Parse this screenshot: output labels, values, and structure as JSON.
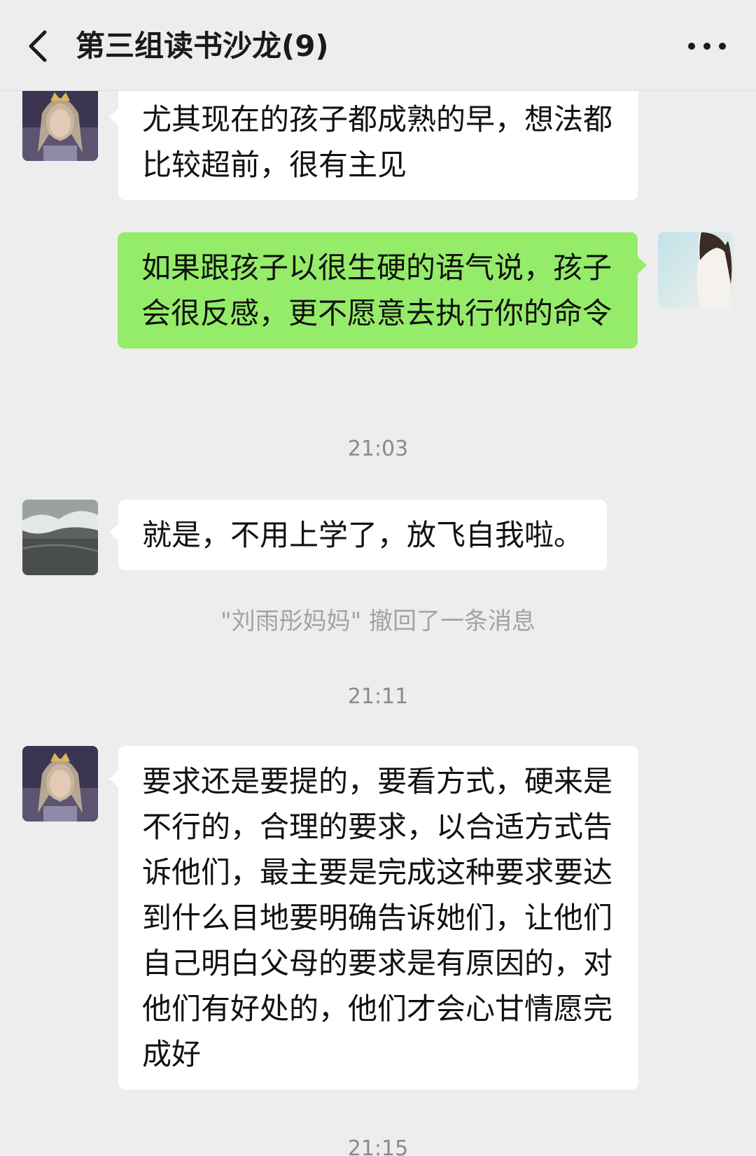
{
  "header": {
    "title": "第三组读书沙龙(9)",
    "back_icon": "chevron-left-icon",
    "more_icon": "more-dots-icon"
  },
  "messages": [
    {
      "side": "left",
      "avatar": "avatar-queen",
      "text": "尤其现在的孩子都成熟的早，想法都比较超前，很有主见"
    },
    {
      "side": "right",
      "avatar": "avatar-woman",
      "text": "如果跟孩子以很生硬的语气说，孩子会很反感，更不愿意去执行你的命令"
    },
    {
      "side": "left",
      "avatar": "avatar-sea",
      "text": "就是，不用上学了，放飞自我啦。"
    },
    {
      "side": "left",
      "avatar": "avatar-queen",
      "text": "要求还是要提的，要看方式，硬来是不行的，合理的要求，以合适方式告诉他们，最主要是完成这种要求要达到什么目地要明确告诉她们，让他们自己明白父母的要求是有原因的，对他们有好处的，他们才会心甘情愿完成好"
    }
  ],
  "timestamps": [
    "21:03",
    "21:11",
    "21:15"
  ],
  "system_notice": "\"刘雨彤妈妈\" 撤回了一条消息",
  "colors": {
    "background": "#ededed",
    "bubble_self": "#95ec69",
    "bubble_other": "#ffffff"
  }
}
